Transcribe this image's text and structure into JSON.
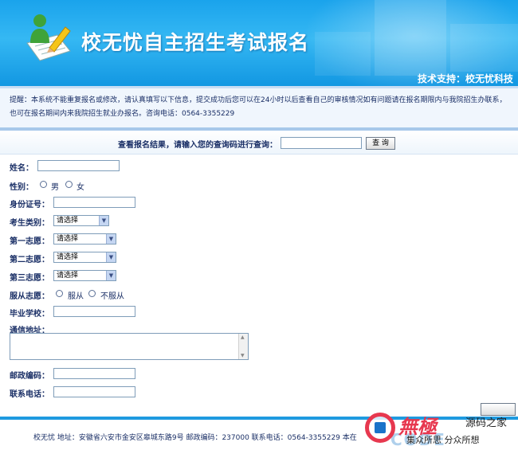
{
  "header": {
    "title": "校无忧自主招生考试报名",
    "tech_support": "技术支持：校无忧科技"
  },
  "notice": {
    "text": "提醒：本系统不能重复报名或修改，请认真填写以下信息，提交成功后您可以在24小时以后查看自己的审核情况如有问题请在报名期限内与我院招生办联系，也可在报名期间内来我院招生就业办报名。咨询电话：0564-3355229"
  },
  "query": {
    "label": "查看报名结果，请输入您的查询码进行查询：",
    "input_value": "",
    "button_label": "查 询"
  },
  "form": {
    "name_label": "姓名：",
    "gender_label": "性别：",
    "gender_male": "男",
    "gender_female": "女",
    "id_label": "身份证号：",
    "category_label": "考生类别：",
    "category_value": "请选择",
    "choice1_label": "第一志愿：",
    "choice1_value": "请选择",
    "choice2_label": "第二志愿：",
    "choice2_value": "请选择",
    "choice3_label": "第三志愿：",
    "choice3_value": "请选择",
    "obey_label": "服从志愿：",
    "obey_yes": "服从",
    "obey_no": "不服从",
    "school_label": "毕业学校：",
    "address_label": "通信地址：",
    "postcode_label": "邮政编码：",
    "phone_label": "联系电话："
  },
  "footer": {
    "text": "校无忧  地址：安徽省六安市金安区皋城东路9号  邮政编码：237000  联系电话：0564-3355229  本在"
  },
  "watermark": {
    "brand": "無極",
    "site_name": "源码之家",
    "slogan": "集众所思 分众所想",
    "code": "CODE"
  },
  "colors": {
    "header_blue": "#1aa3ec",
    "text_navy": "#1a2f66",
    "footer_line": "#1e9ae0",
    "watermark_red": "#e7384f"
  }
}
